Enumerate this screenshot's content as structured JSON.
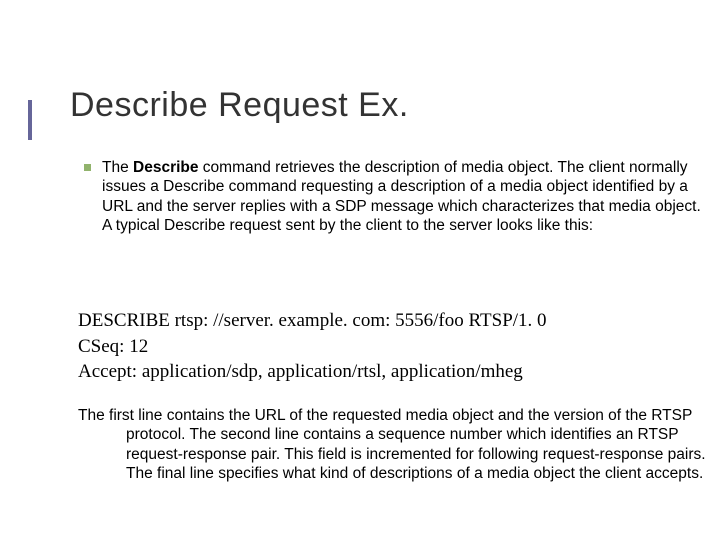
{
  "title": "Describe Request Ex.",
  "bullet": {
    "lead_before": "The ",
    "lead_bold": "Describe",
    "lead_after": " command retrieves the description of media object. The client normally issues a Describe command requesting a description of a media object identified by a URL and the server replies with a SDP message which characterizes that media object. A typical Describe request sent by the client to the server looks like this:"
  },
  "code": {
    "line1": "DESCRIBE rtsp: //server. example. com: 5556/foo RTSP/1. 0",
    "line2": "CSeq: 12",
    "line3": "Accept: application/sdp, application/rtsl, application/mheg"
  },
  "footer": "The first line contains the URL of the requested media object and the version of the RTSP protocol. The second line contains a sequence number which identifies an RTSP request-response pair. This field is incremented for following request-response pairs. The final line specifies what kind of descriptions of a media object the client accepts."
}
